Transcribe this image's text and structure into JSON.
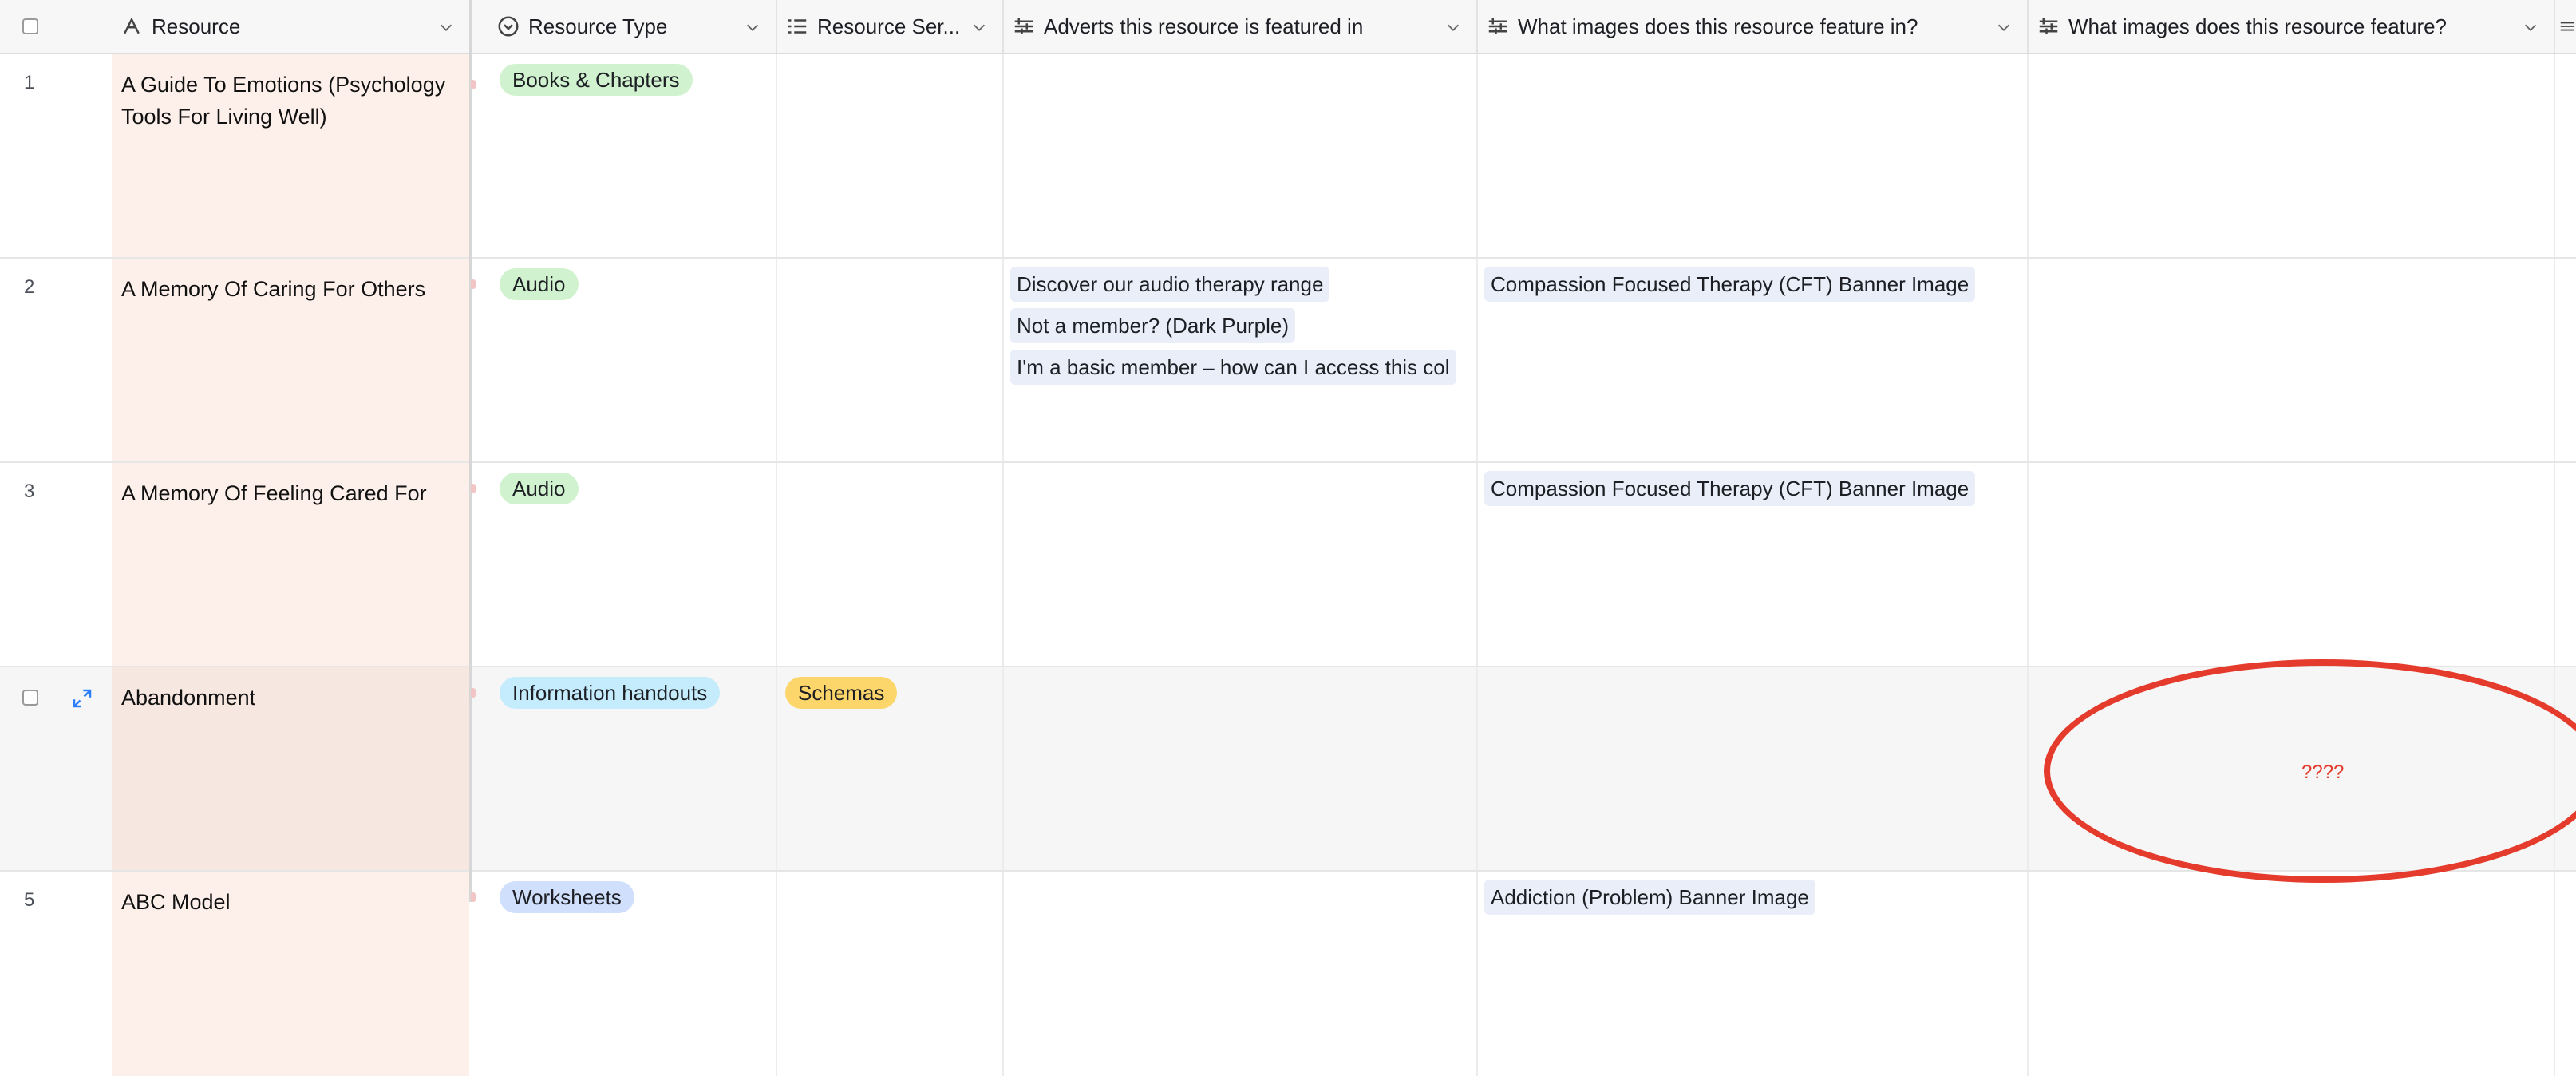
{
  "header": {
    "columns": [
      {
        "label": "Resource",
        "icon": "text-field-icon"
      },
      {
        "label": "Resource Type",
        "icon": "single-select-icon"
      },
      {
        "label": "Resource Ser...",
        "icon": "multiple-select-icon"
      },
      {
        "label": "Adverts this resource is featured in",
        "icon": "linked-record-icon"
      },
      {
        "label": "What images does this resource feature in?",
        "icon": "linked-record-icon"
      },
      {
        "label": "What images does this resource feature?",
        "icon": "linked-record-icon"
      }
    ]
  },
  "rows": [
    {
      "num": "1",
      "resource": "A Guide To Emotions (Psychology Tools For Living Well)",
      "type": {
        "label": "Books & Chapters",
        "color": "#d1f2cf"
      },
      "series": null,
      "adverts": [],
      "images_in": [],
      "images_feature": []
    },
    {
      "num": "2",
      "resource": "A Memory Of Caring For Others",
      "type": {
        "label": "Audio",
        "color": "#d1f2cf"
      },
      "series": null,
      "adverts": [
        "Discover our audio therapy range",
        "Not a member? (Dark Purple)",
        "I'm a basic member – how can I access this col"
      ],
      "images_in": [
        "Compassion Focused Therapy (CFT) Banner Image"
      ],
      "images_feature": []
    },
    {
      "num": "3",
      "resource": "A Memory Of Feeling Cared For",
      "type": {
        "label": "Audio",
        "color": "#d1f2cf"
      },
      "series": null,
      "adverts": [],
      "images_in": [
        "Compassion Focused Therapy (CFT) Banner Image"
      ],
      "images_feature": []
    },
    {
      "num": "",
      "resource": "Abandonment",
      "type": {
        "label": "Information handouts",
        "color": "#c4ecfc"
      },
      "series": {
        "label": "Schemas",
        "color": "#fcd66a"
      },
      "adverts": [],
      "images_in": [],
      "images_feature": []
    },
    {
      "num": "5",
      "resource": "ABC Model",
      "type": {
        "label": "Worksheets",
        "color": "#cfdffc"
      },
      "series": null,
      "adverts": [],
      "images_in": [
        "Addiction (Problem) Banner Image"
      ],
      "images_feature": []
    }
  ],
  "annotation": {
    "text": "????",
    "color": "#e53b2c"
  }
}
